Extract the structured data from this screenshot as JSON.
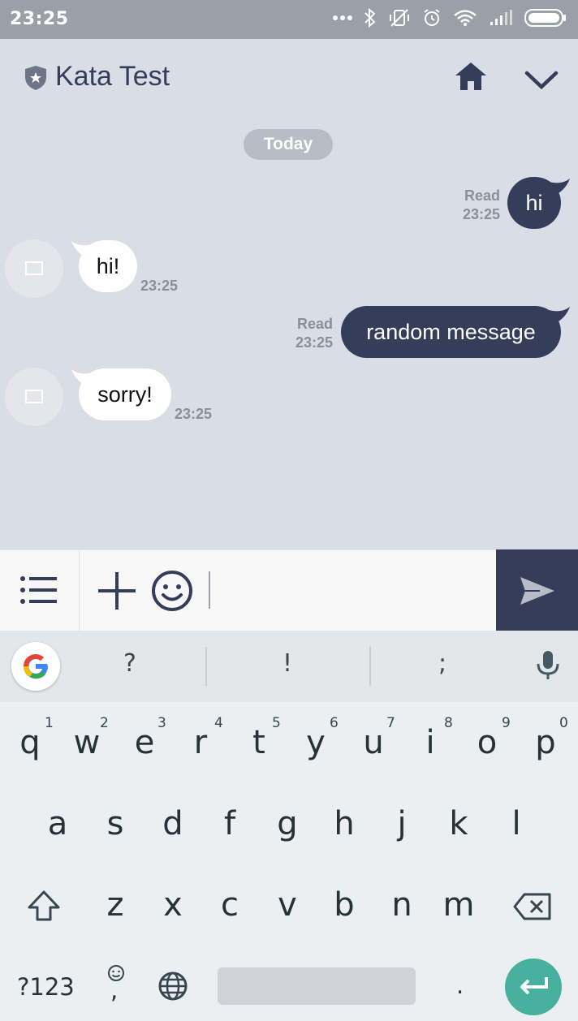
{
  "status_bar": {
    "time": "23:25"
  },
  "header": {
    "title": "Kata Test"
  },
  "chat": {
    "date_divider": "Today",
    "messages": [
      {
        "direction": "out",
        "text": "hi",
        "status": "Read",
        "time": "23:25"
      },
      {
        "direction": "in",
        "text": "hi!",
        "time": "23:25"
      },
      {
        "direction": "out",
        "text": "random message",
        "status": "Read",
        "time": "23:25"
      },
      {
        "direction": "in",
        "text": "sorry!",
        "time": "23:25"
      }
    ]
  },
  "keyboard": {
    "suggestions": [
      "?",
      "!",
      ";"
    ],
    "row1": [
      "q",
      "w",
      "e",
      "r",
      "t",
      "y",
      "u",
      "i",
      "o",
      "p"
    ],
    "row1_hints": [
      "1",
      "2",
      "3",
      "4",
      "5",
      "6",
      "7",
      "8",
      "9",
      "0"
    ],
    "row2": [
      "a",
      "s",
      "d",
      "f",
      "g",
      "h",
      "j",
      "k",
      "l"
    ],
    "row3": [
      "z",
      "x",
      "c",
      "v",
      "b",
      "n",
      "m"
    ],
    "symbols_key": "?123",
    "comma_key": ",",
    "period_key": "."
  },
  "colors": {
    "primary": "#343e5a",
    "chat_bg": "#d9dde6",
    "enter": "#48b09f"
  }
}
